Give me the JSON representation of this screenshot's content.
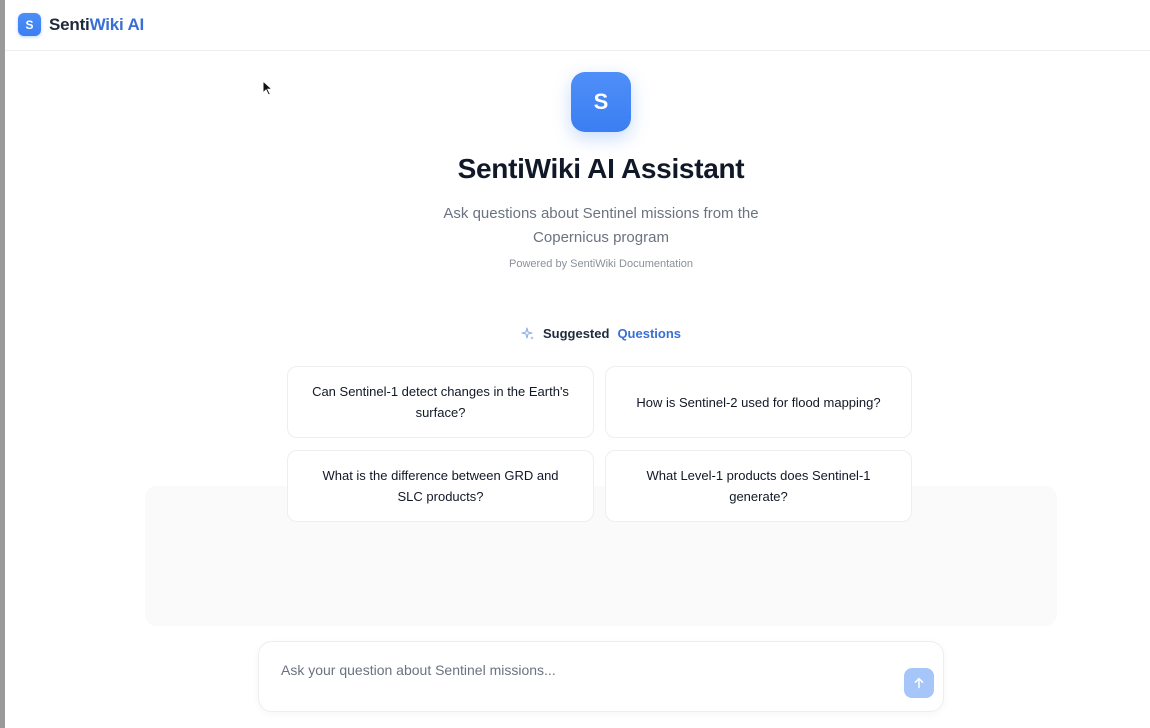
{
  "header": {
    "logo_letter": "S",
    "brand_part_1": "Senti",
    "brand_part_2": "Wiki AI"
  },
  "hero": {
    "logo_letter": "S",
    "title": "SentiWiki AI Assistant",
    "subtitle": "Ask questions about Sentinel missions from the Copernicus program",
    "powered_by": "Powered by SentiWiki Documentation"
  },
  "suggestions": {
    "heading_part_1": "Suggested",
    "heading_part_2": "Questions",
    "icon": "sparkle-icon",
    "questions": [
      "Can Sentinel-1 detect changes in the Earth's surface?",
      "How is Sentinel-2 used for flood mapping?",
      "What is the difference between GRD and SLC products?",
      "What Level-1 products does Sentinel-1 generate?"
    ]
  },
  "composer": {
    "placeholder": "Ask your question about Sentinel missions...",
    "value": "",
    "send_icon": "arrow-up-icon"
  },
  "colors": {
    "accent": "#3b7ef3",
    "brand_blue_text": "#3a6fd6",
    "send_disabled": "#a6c5f8",
    "text_primary": "#111827",
    "text_muted": "#6b7280"
  }
}
